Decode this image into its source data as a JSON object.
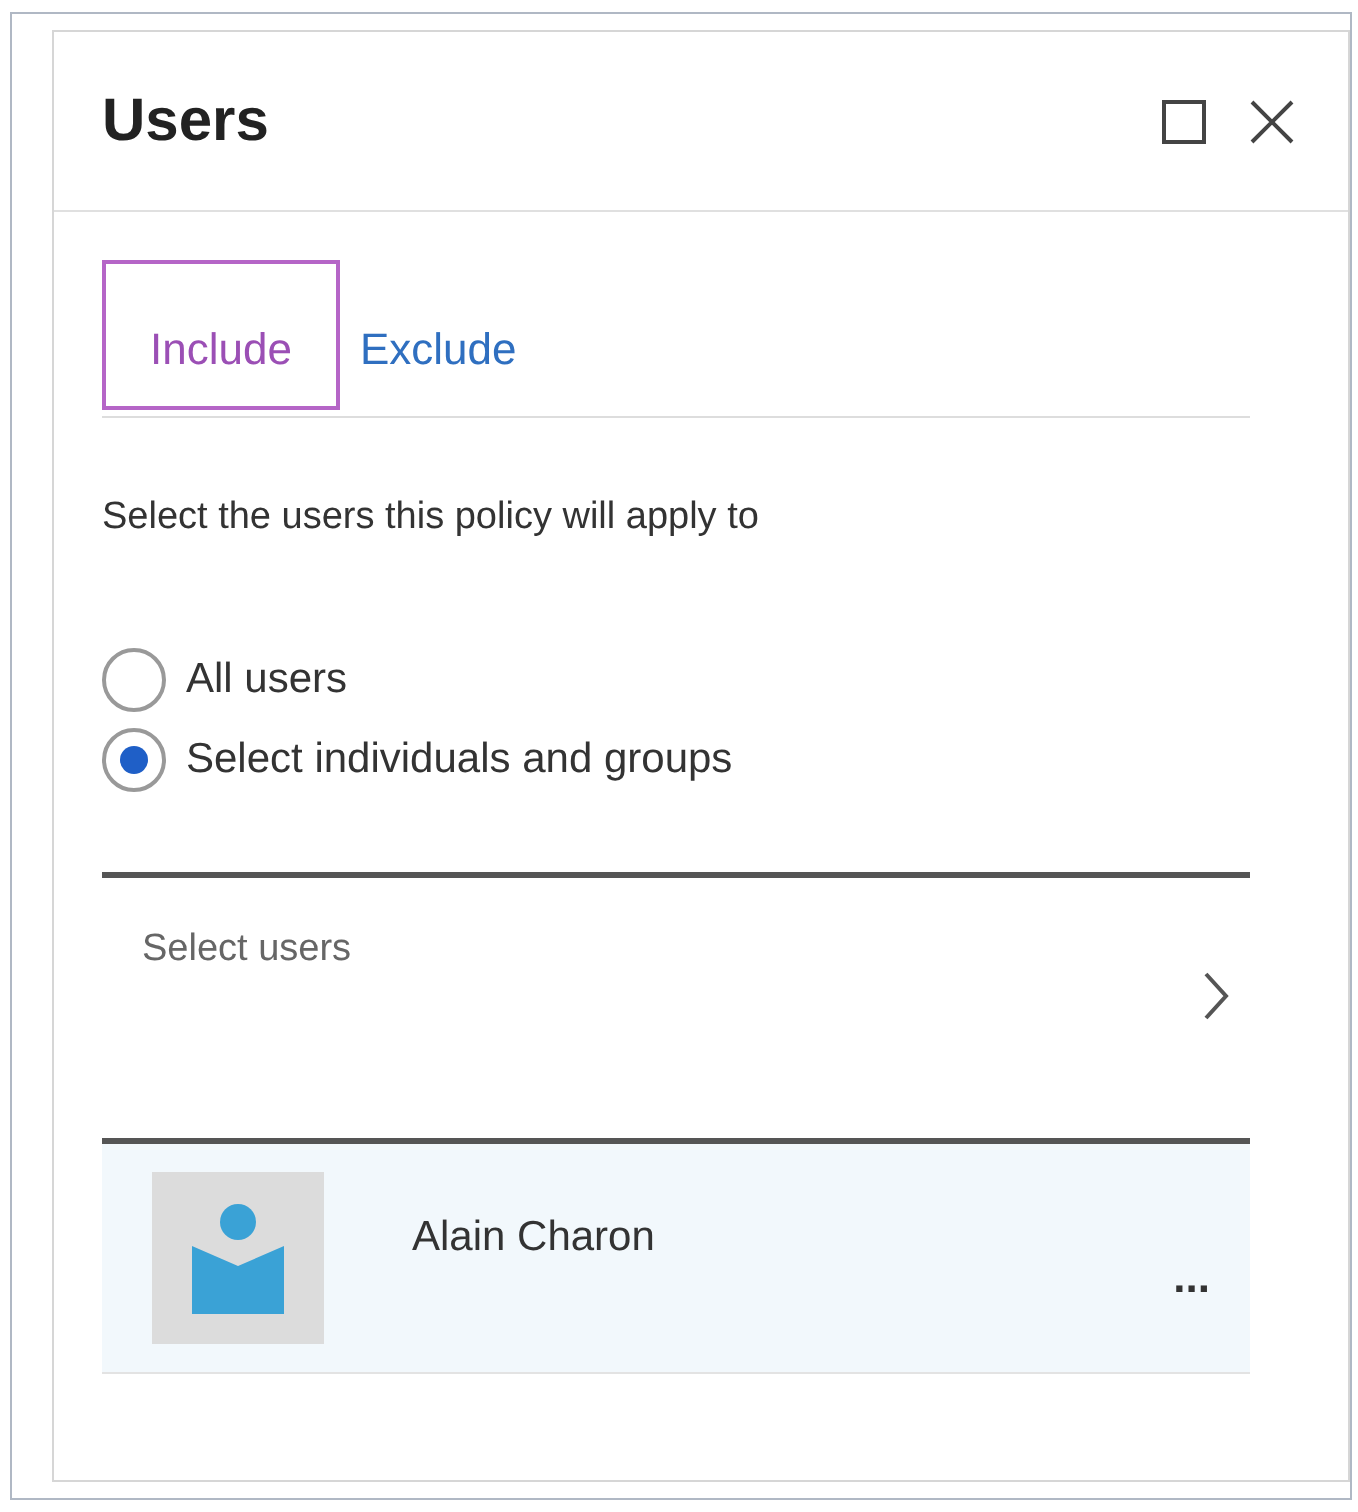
{
  "panel": {
    "title": "Users"
  },
  "tabs": [
    {
      "label": "Include",
      "selected": true
    },
    {
      "label": "Exclude",
      "selected": false
    }
  ],
  "description": "Select the users this policy will apply to",
  "options": [
    {
      "label": "All users",
      "selected": false
    },
    {
      "label": "Select individuals and groups",
      "selected": true
    }
  ],
  "select_users": {
    "label": "Select users"
  },
  "users": [
    {
      "name": "Alain Charon",
      "more": "..."
    }
  ]
}
